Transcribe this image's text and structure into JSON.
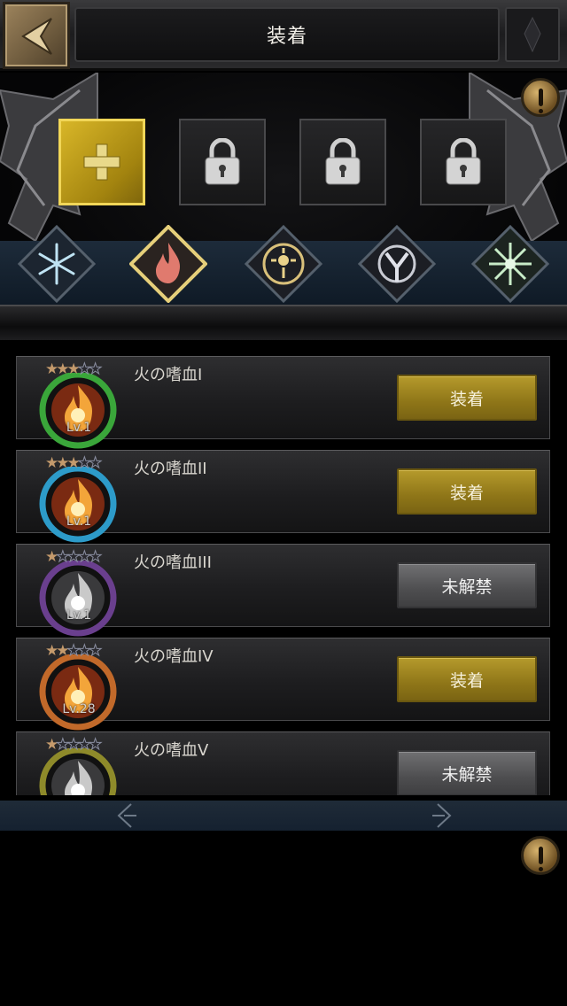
{
  "header": {
    "title": "装着"
  },
  "rows": [
    {
      "name": "火の嗜血I",
      "stars": 3,
      "level": "Lv.1",
      "ring": "#3aa63a",
      "flame": "fire",
      "action": "装着",
      "style": "gold"
    },
    {
      "name": "火の嗜血II",
      "stars": 3,
      "level": "Lv.1",
      "ring": "#2d9bc9",
      "flame": "fire",
      "action": "装着",
      "style": "gold"
    },
    {
      "name": "火の嗜血III",
      "stars": 1,
      "level": "Lv.1",
      "ring": "#6a3f8e",
      "flame": "silver",
      "action": "未解禁",
      "style": "gray"
    },
    {
      "name": "火の嗜血IV",
      "stars": 2,
      "level": "Lv.28",
      "ring": "#c1692a",
      "flame": "fire",
      "action": "装着",
      "style": "gold"
    },
    {
      "name": "火の嗜血V",
      "stars": 1,
      "level": "",
      "ring": "#8e8a2a",
      "flame": "silver",
      "action": "未解禁",
      "style": "gray"
    }
  ],
  "slots": [
    {
      "state": "add",
      "icon": "plus-icon"
    },
    {
      "state": "locked",
      "icon": "padlock-icon"
    },
    {
      "state": "locked",
      "icon": "padlock-icon"
    },
    {
      "state": "locked",
      "icon": "padlock-icon"
    }
  ],
  "elements": [
    {
      "name": "ice",
      "icon": "snowflake-icon",
      "selected": false
    },
    {
      "name": "fire",
      "icon": "flame-icon",
      "selected": true
    },
    {
      "name": "light",
      "icon": "sun-laurel-icon",
      "selected": false
    },
    {
      "name": "wind",
      "icon": "compass-y-icon",
      "selected": false
    },
    {
      "name": "nature",
      "icon": "star-flower-icon",
      "selected": false
    }
  ],
  "colors": {
    "gold_button": "#8f7618",
    "gray_button": "#4e4e50",
    "accent": "#f1d658"
  }
}
